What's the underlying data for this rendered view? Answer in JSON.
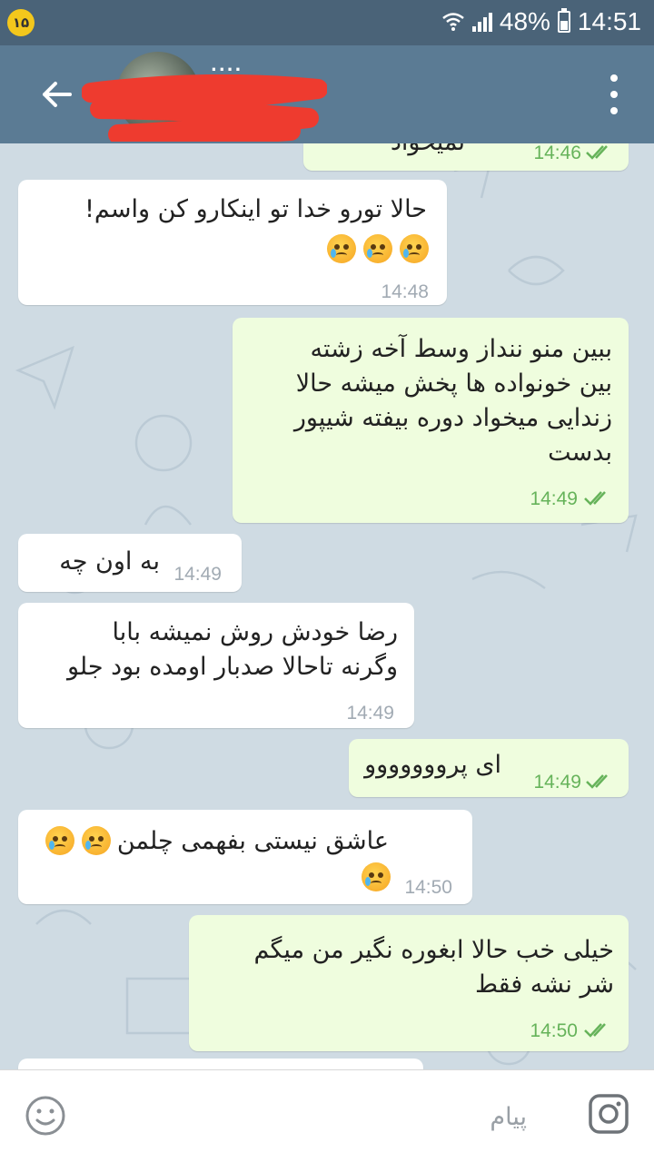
{
  "status_bar": {
    "notification_badge": "۱۵",
    "battery": "48%",
    "time": "14:51",
    "battery_level": 0.48
  },
  "header": {
    "name_fragment": "...."
  },
  "messages": [
    {
      "dir": "out",
      "text": "نمیخواد",
      "time": "14:46"
    },
    {
      "dir": "in",
      "text": "حالا تورو خدا تو اینکارو کن واسم!",
      "time": "14:48",
      "emoji_count": 3
    },
    {
      "dir": "out",
      "text": "ببین منو ننداز وسط آخه زشته\nبین خونواده ها پخش میشه حالا\nزندایی میخواد دوره بیفته شیپور\nبدست",
      "time": "14:49"
    },
    {
      "dir": "in",
      "text": "به اون چه",
      "time": "14:49"
    },
    {
      "dir": "in",
      "text": "رضا خودش روش نمیشه بابا\nوگرنه تاحالا صدبار اومده بود جلو",
      "time": "14:49"
    },
    {
      "dir": "out",
      "text": "ای پرووووووو",
      "time": "14:49"
    },
    {
      "dir": "in",
      "text": "عاشق نیستی بفهمی چلمن",
      "time": "14:50",
      "emoji_count": 3
    },
    {
      "dir": "out",
      "text": "خیلی خب حالا ابغوره نگیر من میگم\nشر نشه فقط",
      "time": "14:50"
    }
  ],
  "input": {
    "placeholder": "پیام"
  },
  "colors": {
    "header": "#5b7b94",
    "status_bar": "#4a6378",
    "outgoing_bubble": "#effdde",
    "incoming_bubble": "#ffffff",
    "tick": "#66b35a"
  }
}
